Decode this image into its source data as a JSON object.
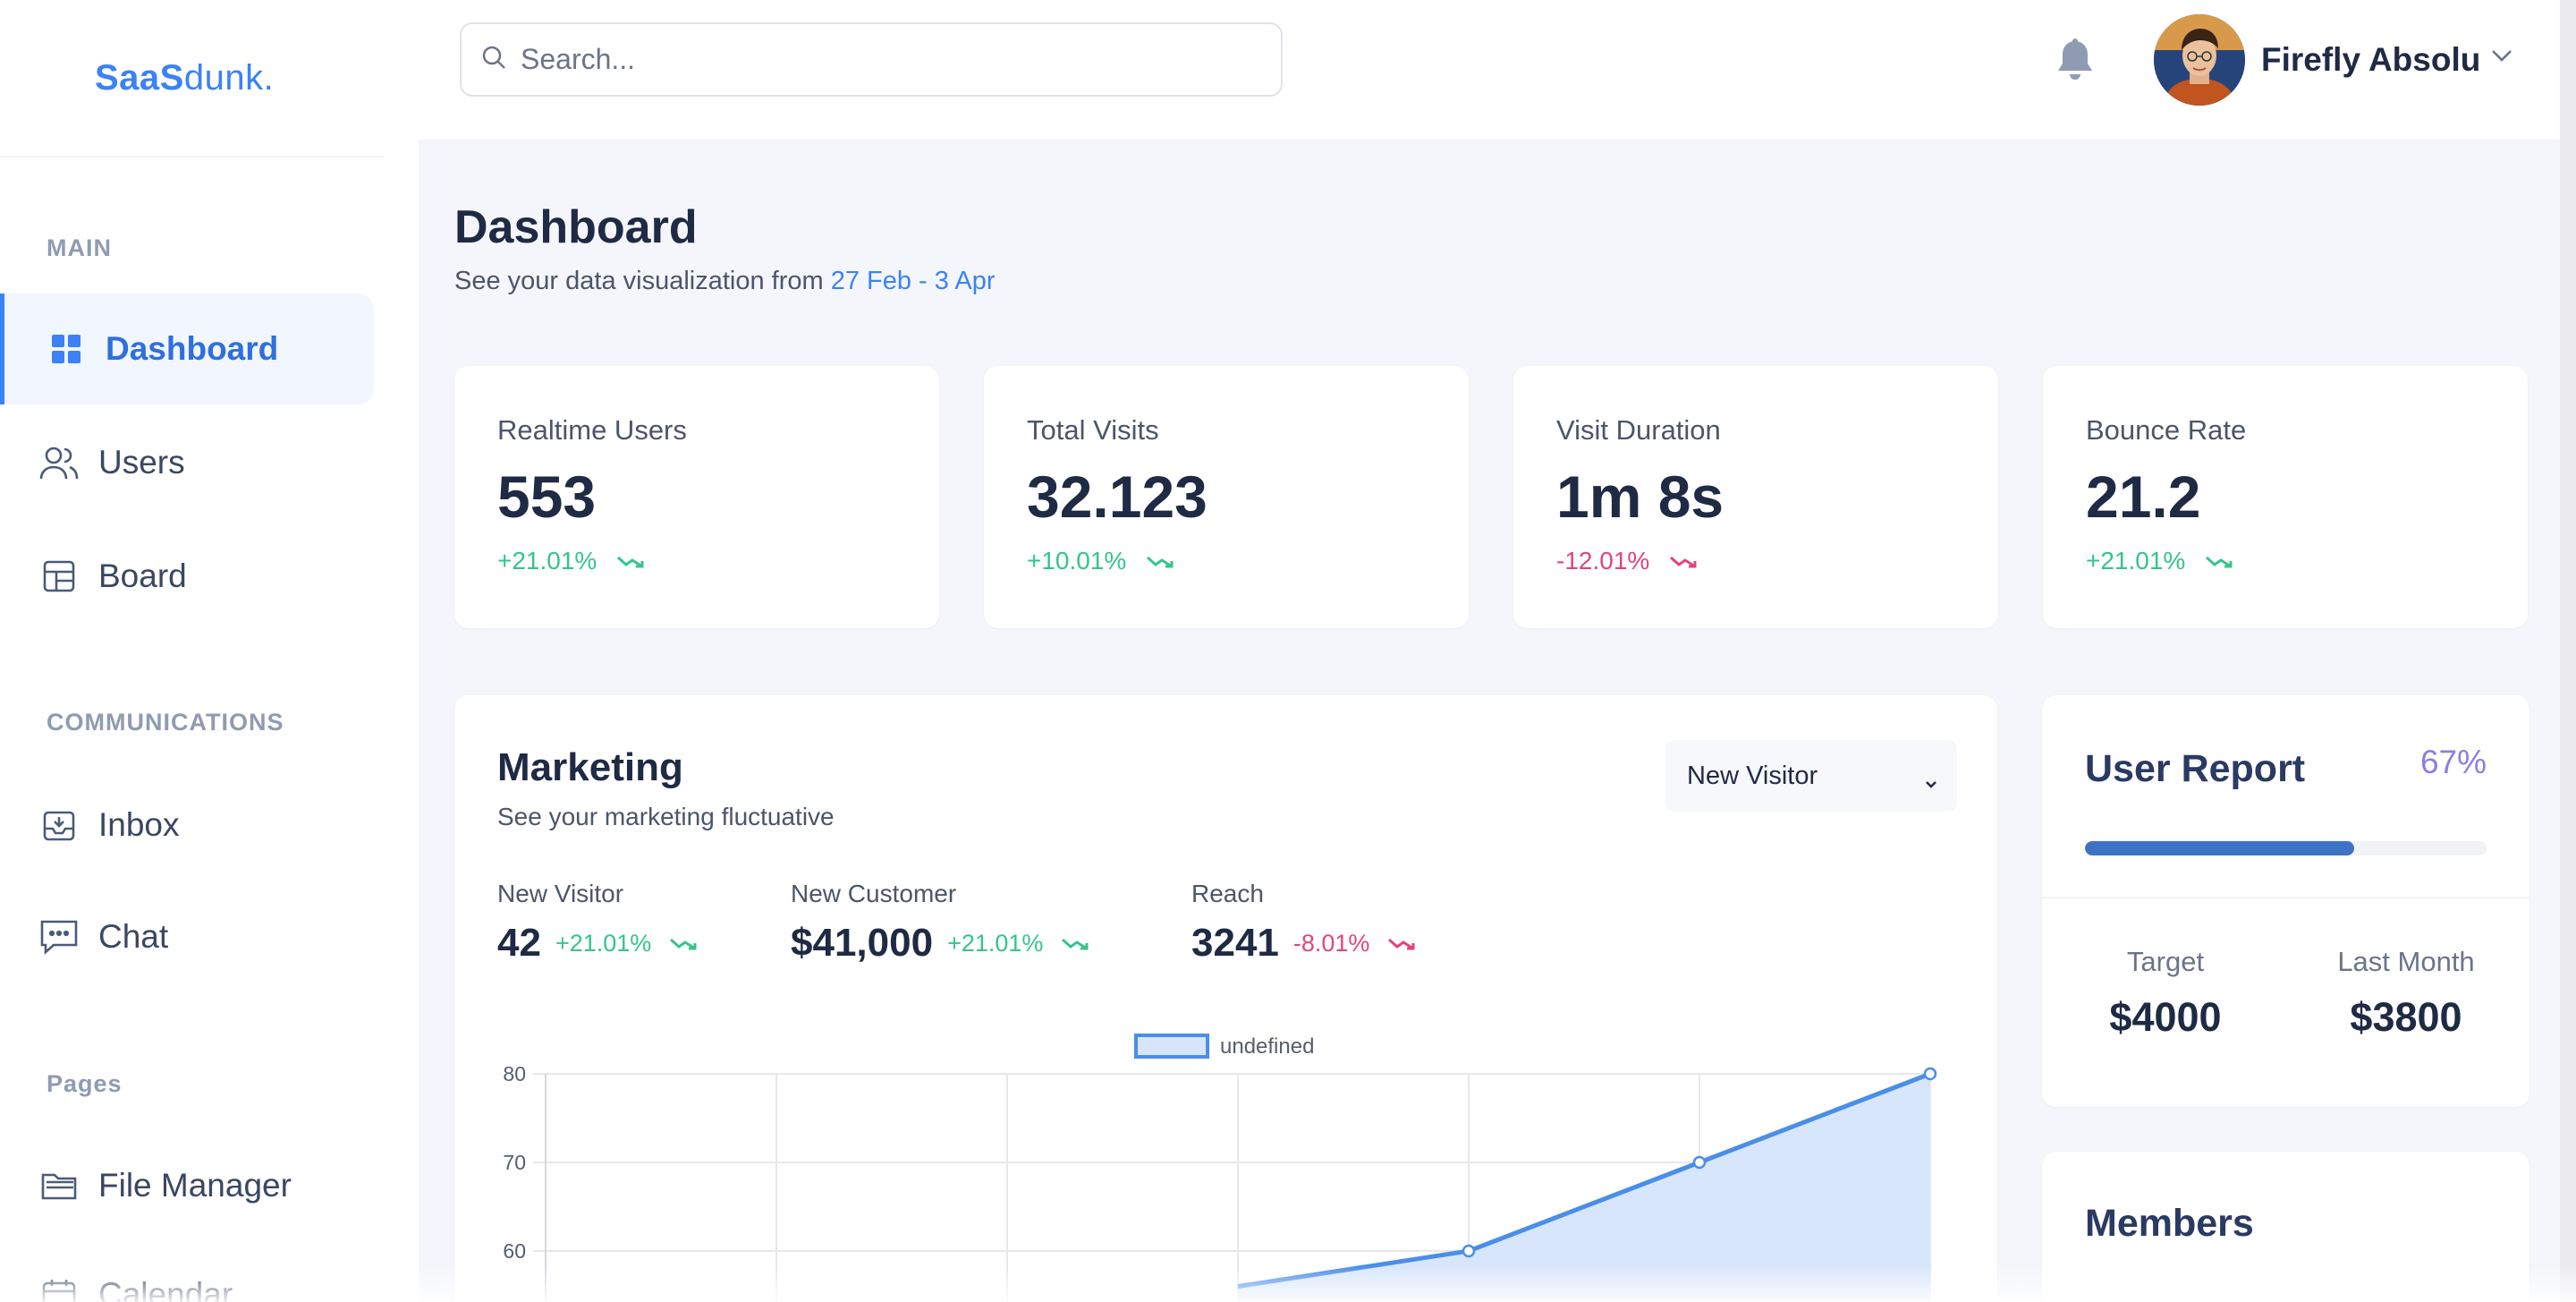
{
  "app": {
    "logo_bold": "SaaS",
    "logo_light": "dunk."
  },
  "sidebar": {
    "sections": [
      {
        "title": "MAIN",
        "items": [
          {
            "label": "Dashboard",
            "icon": "dashboard-grid-icon",
            "active": true
          },
          {
            "label": "Users",
            "icon": "users-icon"
          },
          {
            "label": "Board",
            "icon": "board-icon"
          }
        ]
      },
      {
        "title": "COMMUNICATIONS",
        "items": [
          {
            "label": "Inbox",
            "icon": "inbox-icon"
          },
          {
            "label": "Chat",
            "icon": "chat-icon"
          }
        ]
      },
      {
        "title": "Pages",
        "items": [
          {
            "label": "File Manager",
            "icon": "folder-icon"
          },
          {
            "label": "Calendar",
            "icon": "calendar-icon"
          }
        ]
      }
    ]
  },
  "topbar": {
    "search_placeholder": "Search...",
    "user_name": "Firefly Absolu"
  },
  "page": {
    "title": "Dashboard",
    "subtitle_prefix": "See your data visualization from ",
    "date_range": "27 Feb - 3 Apr"
  },
  "stats": [
    {
      "label": "Realtime Users",
      "value": "553",
      "delta": "+21.01%",
      "trend": "up"
    },
    {
      "label": "Total Visits",
      "value": "32.123",
      "delta": "+10.01%",
      "trend": "up"
    },
    {
      "label": "Visit Duration",
      "value": "1m 8s",
      "delta": "-12.01%",
      "trend": "down"
    },
    {
      "label": "Bounce Rate",
      "value": "21.2",
      "delta": "+21.01%",
      "trend": "up"
    }
  ],
  "marketing": {
    "title": "Marketing",
    "subtitle": "See your marketing fluctuative",
    "select_value": "New Visitor",
    "metrics": [
      {
        "label": "New Visitor",
        "value": "42",
        "delta": "+21.01%",
        "trend": "up"
      },
      {
        "label": "New Customer",
        "value": "$41,000",
        "delta": "+21.01%",
        "trend": "up"
      },
      {
        "label": "Reach",
        "value": "3241",
        "delta": "-8.01%",
        "trend": "down"
      }
    ]
  },
  "chart_data": {
    "type": "area",
    "legend": [
      "undefined"
    ],
    "legend_position": "top",
    "y_ticks": [
      "80",
      "70",
      "60"
    ],
    "series": [
      {
        "name": "undefined",
        "values": [
          null,
          null,
          null,
          56,
          60,
          70,
          80
        ]
      }
    ],
    "grid": true,
    "colors": {
      "line": "#4a8ee8",
      "fill": "#d6e5fb"
    }
  },
  "user_report": {
    "title": "User Report",
    "percent_label": "67%",
    "progress": 0.67,
    "target_label": "Target",
    "target_value": "$4000",
    "last_month_label": "Last Month",
    "last_month_value": "$3800"
  },
  "members": {
    "title": "Members"
  },
  "colors": {
    "accent": "#3b82f6",
    "positive": "#34c58a",
    "negative": "#e0457b",
    "progress": "#3e72c5",
    "percent": "#8b7fe3"
  }
}
